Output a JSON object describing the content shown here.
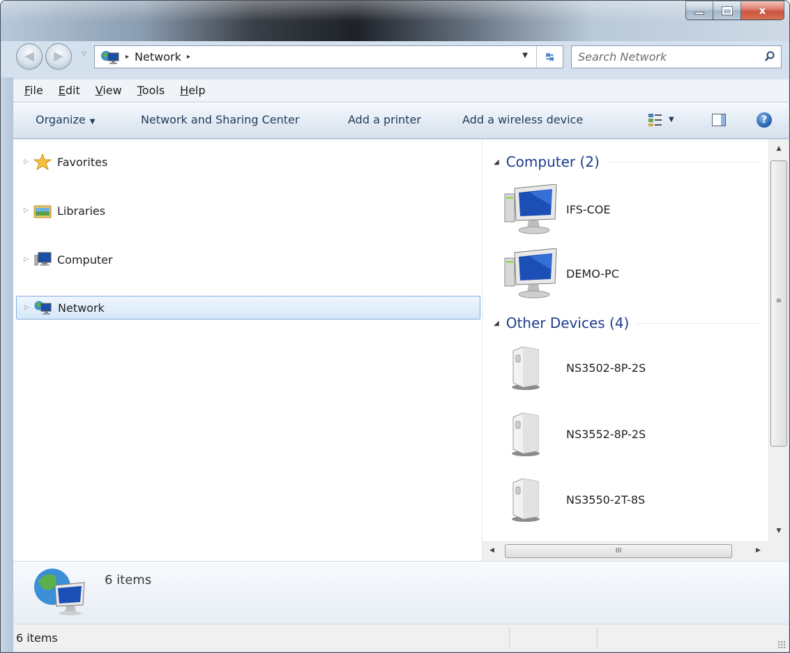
{
  "window": {
    "caption_minimize": "minimize",
    "caption_maximize": "maximize",
    "caption_close": "x"
  },
  "address": {
    "path": [
      "Network"
    ],
    "separator": "▸"
  },
  "search": {
    "placeholder": "Search Network"
  },
  "menubar": {
    "items": [
      {
        "accel": "F",
        "rest": "ile"
      },
      {
        "accel": "E",
        "rest": "dit"
      },
      {
        "accel": "V",
        "rest": "iew"
      },
      {
        "accel": "T",
        "rest": "ools"
      },
      {
        "accel": "H",
        "rest": "elp"
      }
    ]
  },
  "commandbar": {
    "organize": "Organize",
    "network_sharing": "Network and Sharing Center",
    "add_printer": "Add a printer",
    "add_wireless": "Add a wireless device",
    "help": "?"
  },
  "navpane": {
    "items": [
      {
        "label": "Favorites",
        "icon": "star-icon"
      },
      {
        "label": "Libraries",
        "icon": "libraries-icon"
      },
      {
        "label": "Computer",
        "icon": "computer-icon"
      },
      {
        "label": "Network",
        "icon": "network-icon",
        "selected": true
      }
    ]
  },
  "content": {
    "groups": [
      {
        "title": "Computer (2)",
        "items": [
          {
            "label": "IFS-COE",
            "icon": "computer-icon"
          },
          {
            "label": "DEMO-PC",
            "icon": "computer-icon"
          }
        ]
      },
      {
        "title": "Other Devices (4)",
        "items": [
          {
            "label": "NS3502-8P-2S",
            "icon": "device-icon"
          },
          {
            "label": "NS3552-8P-2S",
            "icon": "device-icon"
          },
          {
            "label": "NS3550-2T-8S",
            "icon": "device-icon"
          }
        ]
      }
    ]
  },
  "scroll": {
    "vgrip": "≡",
    "hgrip": "III"
  },
  "details": {
    "text": "6 items"
  },
  "status": {
    "text": "6 items"
  },
  "colors": {
    "group_title": "#1e3c8c",
    "selection_border": "#84acdd",
    "command_text": "#1e3a5c"
  }
}
